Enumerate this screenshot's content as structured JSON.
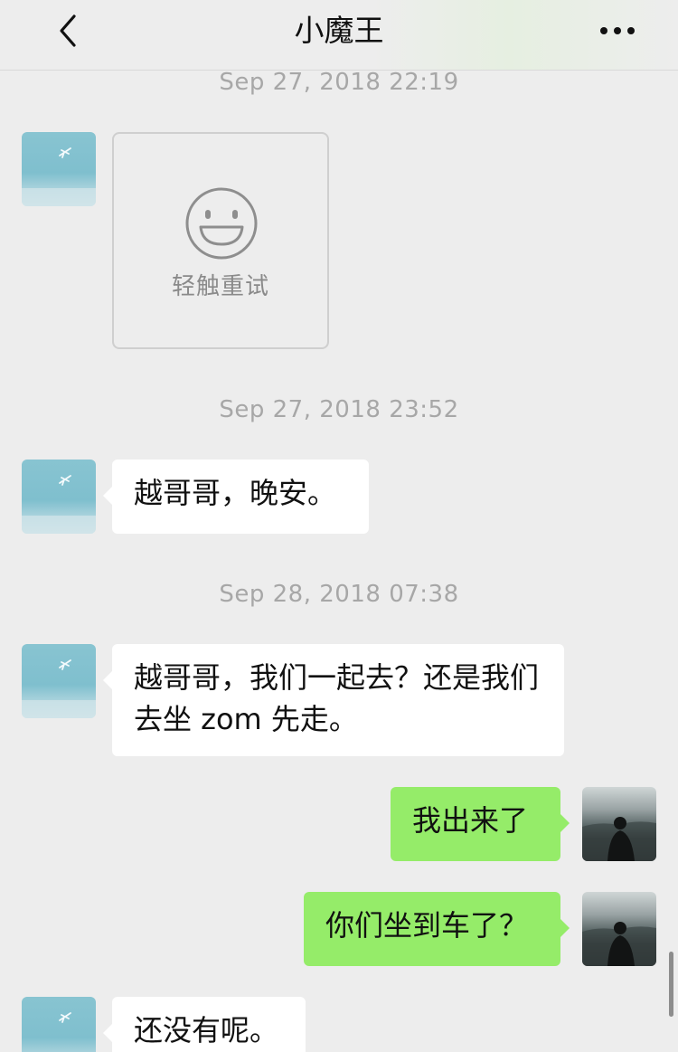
{
  "nav": {
    "title": "小魔王",
    "back_icon": "chevron-left-icon",
    "more_icon": "ellipsis-icon"
  },
  "messages": [
    {
      "type": "timestamp",
      "text": "Sep 27, 2018 22:19"
    },
    {
      "type": "incoming-sticker",
      "sticker_icon": "smiley-icon",
      "retry_label": "轻触重试"
    },
    {
      "type": "timestamp",
      "text": "Sep 27, 2018 23:52"
    },
    {
      "type": "incoming-text",
      "text": "越哥哥，晚安。"
    },
    {
      "type": "timestamp",
      "text": "Sep 28, 2018 07:38"
    },
    {
      "type": "incoming-text",
      "text": "越哥哥，我们一起去？还是我们去坐 zom 先走。"
    },
    {
      "type": "outgoing-text",
      "text": "我出来了"
    },
    {
      "type": "outgoing-text",
      "text": "你们坐到车了？"
    },
    {
      "type": "incoming-text",
      "text": "还没有呢。"
    }
  ],
  "colors": {
    "background": "#ededed",
    "incoming_bubble": "#ffffff",
    "outgoing_bubble": "#95ec69",
    "timestamp_text": "#a7a7a7"
  }
}
